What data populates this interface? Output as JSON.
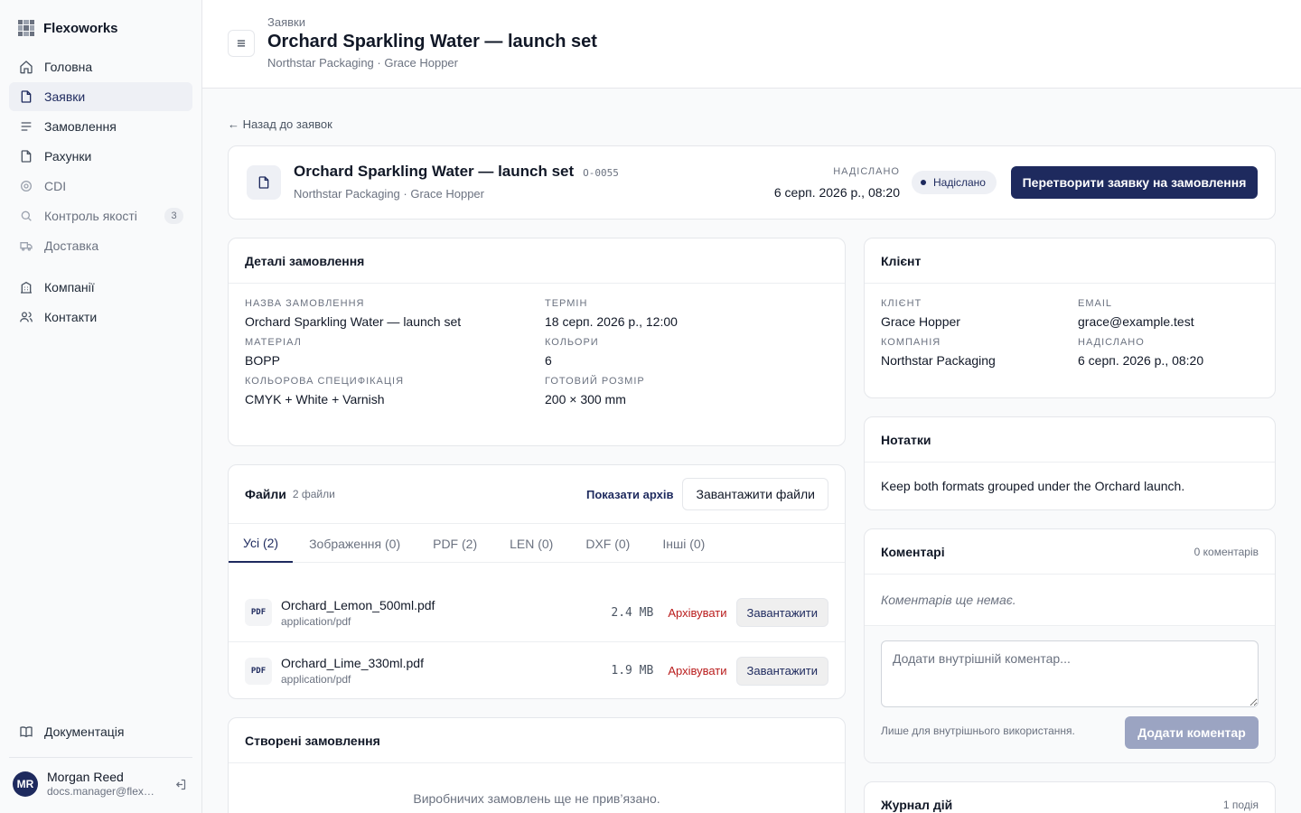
{
  "sidebar": {
    "brand": "Flexoworks",
    "items": [
      {
        "label": "Головна",
        "icon": "home-icon"
      },
      {
        "label": "Заявки",
        "icon": "file-icon",
        "active": true
      },
      {
        "label": "Замовлення",
        "icon": "list-icon"
      },
      {
        "label": "Рахунки",
        "icon": "file-icon"
      },
      {
        "label": "CDI",
        "icon": "target-icon"
      },
      {
        "label": "Контроль якості",
        "icon": "search-icon",
        "badge": "3"
      },
      {
        "label": "Доставка",
        "icon": "truck-icon"
      },
      {
        "label": "Компанії",
        "icon": "building-icon"
      },
      {
        "label": "Контакти",
        "icon": "users-icon"
      }
    ],
    "docs": "Документація",
    "user": {
      "initials": "MR",
      "name": "Morgan Reed",
      "email": "docs.manager@flexoworks.test"
    }
  },
  "header": {
    "crumb": "Заявки",
    "title": "Orchard Sparkling Water — launch set",
    "subtitle": "Northstar Packaging · Grace Hopper"
  },
  "back_link": "← Назад до заявок",
  "summary": {
    "title": "Orchard Sparkling Water — launch set",
    "code": "O-0055",
    "subtitle": "Northstar Packaging · Grace Hopper",
    "date_label": "НАДІСЛАНО",
    "date": "6 серп. 2026 р., 08:20",
    "status": "Надіслано",
    "convert_label": "Перетворити заявку на замовлення"
  },
  "details": {
    "title": "Деталі замовлення",
    "fields": [
      {
        "label": "Назва замовлення",
        "value": "Orchard Sparkling Water — launch set"
      },
      {
        "label": "Термін",
        "value": "18 серп. 2026 р., 12:00"
      },
      {
        "label": "Матеріал",
        "value": "BOPP"
      },
      {
        "label": "Кольори",
        "value": "6"
      },
      {
        "label": "Кольорова специфікація",
        "value": "CMYK + White + Varnish"
      },
      {
        "label": "Готовий розмір",
        "value": "200 × 300 mm"
      }
    ]
  },
  "client": {
    "title": "Клієнт",
    "fields": [
      {
        "label": "Клієнт",
        "value": "Grace Hopper"
      },
      {
        "label": "Email",
        "value": "grace@example.test"
      },
      {
        "label": "Компанія",
        "value": "Northstar Packaging"
      },
      {
        "label": "Надіслано",
        "value": "6 серп. 2026 р., 08:20"
      }
    ]
  },
  "files": {
    "title": "Файли",
    "count": "2 файли",
    "show_archive": "Показати архів",
    "upload": "Завантажити файли",
    "tabs": [
      "Усі (2)",
      "Зображення (0)",
      "PDF (2)",
      "LEN (0)",
      "DXF (0)",
      "Інші (0)"
    ],
    "rows": [
      {
        "badge": "PDF",
        "name": "Orchard_Lemon_500ml.pdf",
        "type": "application/pdf",
        "size": "2.4 MB",
        "archive": "Архівувати",
        "download": "Завантажити"
      },
      {
        "badge": "PDF",
        "name": "Orchard_Lime_330ml.pdf",
        "type": "application/pdf",
        "size": "1.9 MB",
        "archive": "Архівувати",
        "download": "Завантажити"
      }
    ]
  },
  "orders": {
    "title": "Створені замовлення",
    "empty": "Виробничих замовлень ще не прив’язано."
  },
  "notes": {
    "title": "Нотатки",
    "body": "Keep both formats grouped under the Orchard launch."
  },
  "comments": {
    "title": "Коментарі",
    "count": "0 коментарів",
    "empty": "Коментарів ще немає.",
    "placeholder": "Додати внутрішній коментар...",
    "note": "Лише для внутрішнього використання.",
    "add": "Додати коментар"
  },
  "log": {
    "title": "Журнал дій",
    "count": "1 подія"
  },
  "colors": {
    "accent": "#1e2a5e",
    "danger": "#b91c1c",
    "disabled": "#9ba4c2"
  }
}
